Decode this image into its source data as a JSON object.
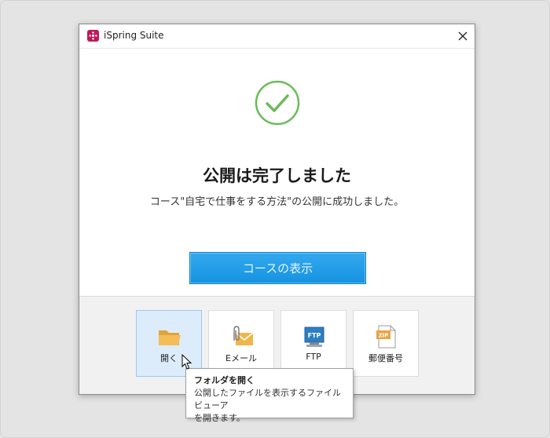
{
  "window": {
    "title": "iSpring Suite",
    "close_label": "×"
  },
  "main": {
    "heading": "公開は完了しました",
    "message": "コース\"自宅で仕事をする方法\"の公開に成功しました。",
    "primary_button": "コースの表示"
  },
  "footer": {
    "tiles": [
      {
        "label": "開く",
        "icon": "folder-icon"
      },
      {
        "label": "Eメール",
        "icon": "email-icon"
      },
      {
        "label": "FTP",
        "icon": "ftp-icon",
        "badge": "FTP"
      },
      {
        "label": "郵便番号",
        "icon": "zip-icon",
        "badge": "ZIP"
      }
    ]
  },
  "tooltip": {
    "title": "フォルダを開く",
    "line1": "公開したファイルを表示するファイルビューア",
    "line2": "を開きます。"
  },
  "colors": {
    "accent": "#1592e0",
    "success": "#6cbb5a",
    "app_icon": "#c2185b"
  }
}
